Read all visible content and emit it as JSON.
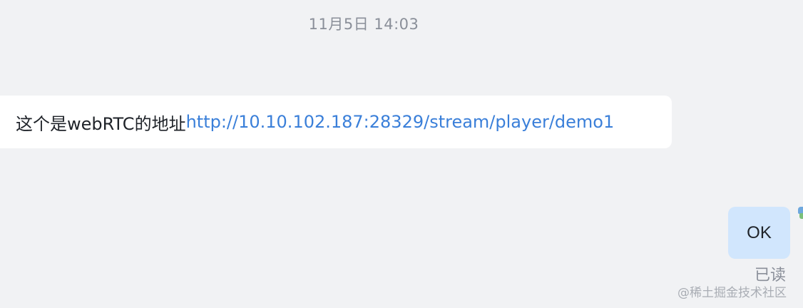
{
  "chat": {
    "timestamp": "11月5日 14:03",
    "incoming": {
      "text": "这个是webRTC的地址",
      "link": "http://10.10.102.187:28329/stream/player/demo1"
    },
    "outgoing": {
      "text": "OK",
      "read_status": "已读"
    }
  },
  "watermark": "@稀土掘金技术社区",
  "colors": {
    "background": "#f1f2f4",
    "incoming_bubble": "#ffffff",
    "outgoing_bubble": "#d1e6fd",
    "link": "#3a7fd9",
    "muted_text": "#8a8f99"
  }
}
